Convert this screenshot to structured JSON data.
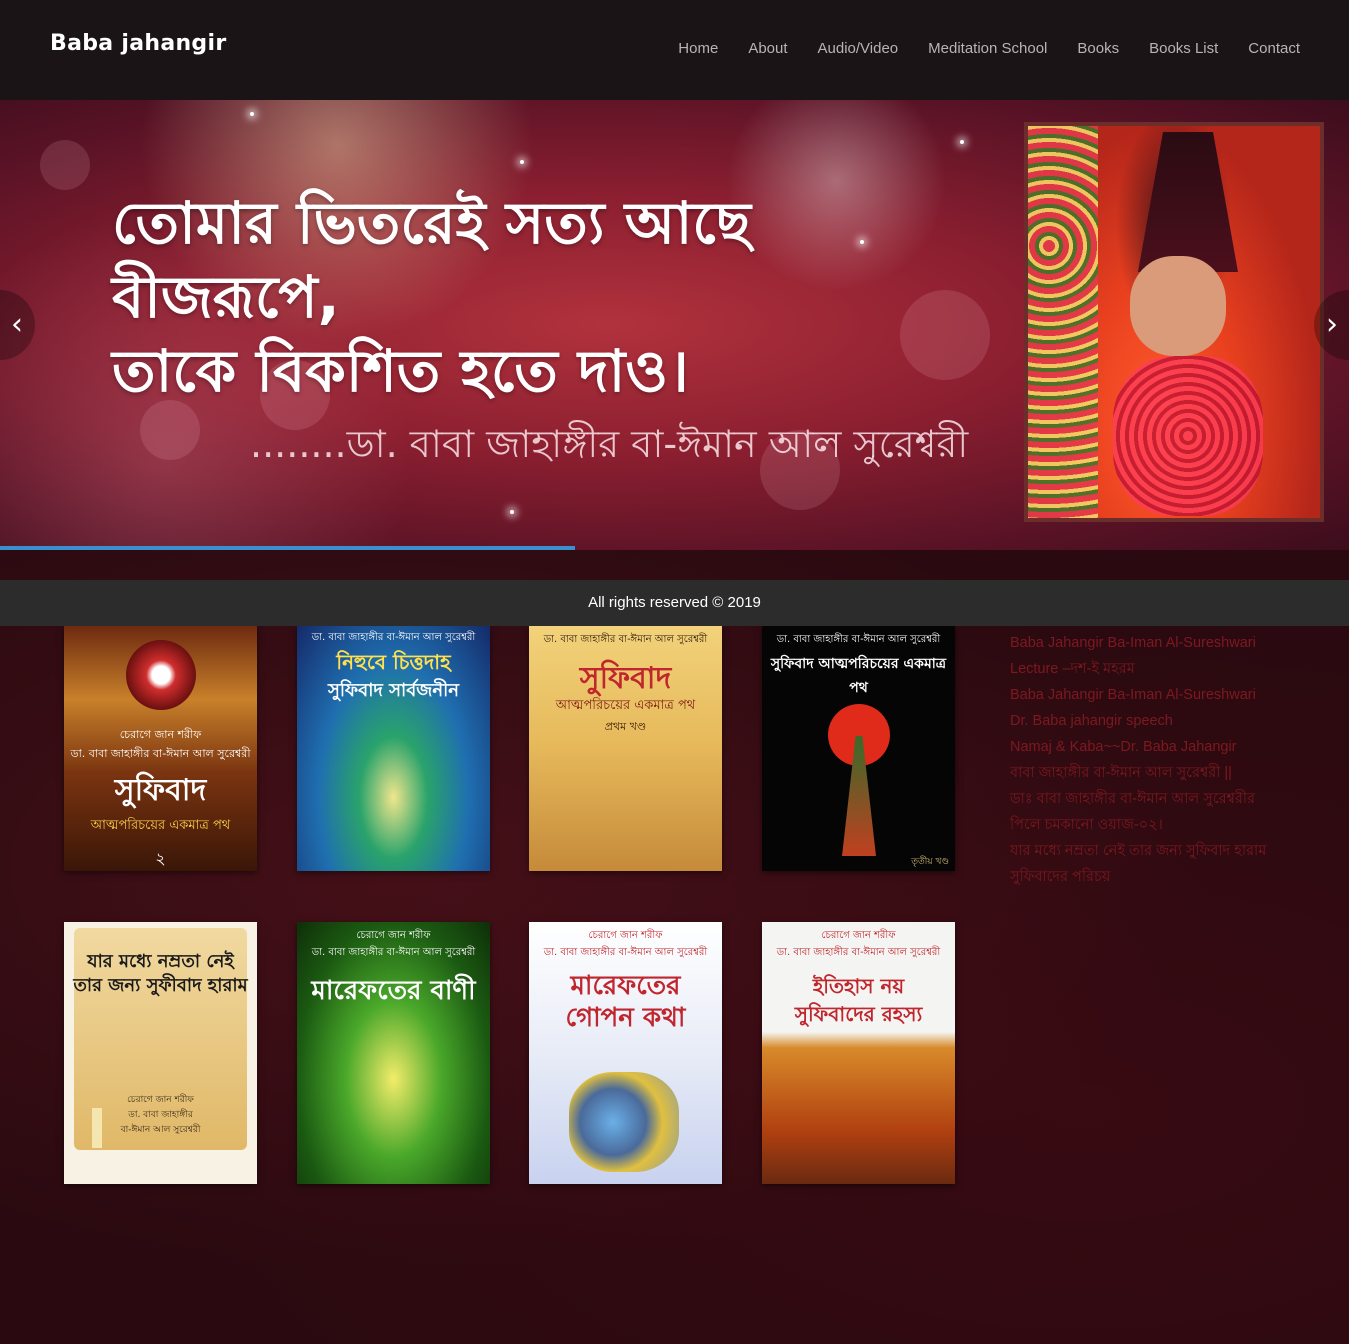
{
  "header": {
    "logo": "Baba jahangir",
    "nav": [
      "Home",
      "About",
      "Audio/Video",
      "Meditation School",
      "Books",
      "Books List",
      "Contact"
    ]
  },
  "slider": {
    "quote_line1": "তোমার ভিতরেই সত্য আছে বীজরূপে,",
    "quote_line2": "তাকে বিকশিত হতে দাও।",
    "author": "........ডা. বাবা জাহাঙ্গীর বা-ঈমান আল সুরেশ্বরী",
    "prev_arrow": "‹",
    "next_arrow": "›",
    "progress_fraction": 0.426
  },
  "footer": {
    "copyright": "All rights reserved © 2019"
  },
  "books": [
    {
      "author": "চেরাগে জান শরীফ\nডা. বাবা জাহাঙ্গীর বা-ঈমান আল সুরেশ্বরী",
      "title": "সুফিবাদ",
      "subtitle": "আত্মপরিচয়ের একমাত্র পথ",
      "extra": "২"
    },
    {
      "author": "ডা. বাবা জাহাঙ্গীর বা-ঈমান আল সুরেশ্বরী",
      "title": "নিহুবে চিত্তদাহ",
      "subtitle": "সুফিবাদ সার্বজনীন",
      "extra": ""
    },
    {
      "author": "ডা. বাবা জাহাঙ্গীর বা-ঈমান আল সুরেশ্বরী",
      "title": "সুফিবাদ",
      "subtitle": "আত্মপরিচয়ের একমাত্র পথ",
      "extra": "প্রথম খণ্ড"
    },
    {
      "author": "ডা. বাবা জাহাঙ্গীর বা-ঈমান আল সুরেশ্বরী",
      "title": "সুফিবাদ আত্মপরিচয়ের একমাত্র পথ",
      "subtitle": "",
      "extra": "তৃতীয় খণ্ড"
    },
    {
      "author": "চেরাগে জান শরীফ\nডা. বাবা জাহাঙ্গীর\nবা-ঈমান আল সুরেশ্বরী",
      "title": "যার মধ্যে নম্রতা নেই তার জন্য সুফীবাদ হারাম",
      "subtitle": "",
      "extra": ""
    },
    {
      "author": "চেরাগে জান শরীফ\nডা. বাবা জাহাঙ্গীর বা-ঈমান আল সুরেশ্বরী",
      "title": "মারেফতের বাণী",
      "subtitle": "",
      "extra": ""
    },
    {
      "author": "চেরাগে জান শরীফ\nডা. বাবা জাহাঙ্গীর বা-ঈমান আল সুরেশ্বরী",
      "title": "মারেফতের গোপন কথা",
      "subtitle": "",
      "extra": ""
    },
    {
      "author": "চেরাগে জান শরীফ\nডা. বাবা জাহাঙ্গীর বা-ঈমান আল সুরেশ্বরী",
      "title": "ইতিহাস নয় সুফিবাদের রহস্য",
      "subtitle": "",
      "extra": ""
    }
  ],
  "sidebar": {
    "links": [
      "Baba Jahangir Ba-Iman Al-Sureshwari",
      "Lecture –দশ-ই মহরম",
      "Baba Jahangir Ba-Iman Al-Sureshwari",
      "Dr. Baba jahangir speech",
      "Namaj & Kaba~~Dr. Baba Jahangir",
      "বাবা জাহাঙ্গীর বা-ঈমান আল সুরেশ্বরী ||",
      "ডাঃ বাবা জাহাঙ্গীর বা-ঈমান আল সুরেশ্বরীর",
      "পিলে চমকানো ওয়াজ-০২।",
      "যার মধ্যে নম্রতা নেই তার জন্য সুফিবাদ হারাম",
      "সুফিবাদের পরিচয়"
    ]
  },
  "colors": {
    "header_bg": "#1b1416",
    "nav_text": "#b9b3b4",
    "slider_progress": "#3a8fd1",
    "footer_bg": "#2d2c2c",
    "sidebar_link": "#7e1820",
    "page_bg": "#2a0a10"
  }
}
